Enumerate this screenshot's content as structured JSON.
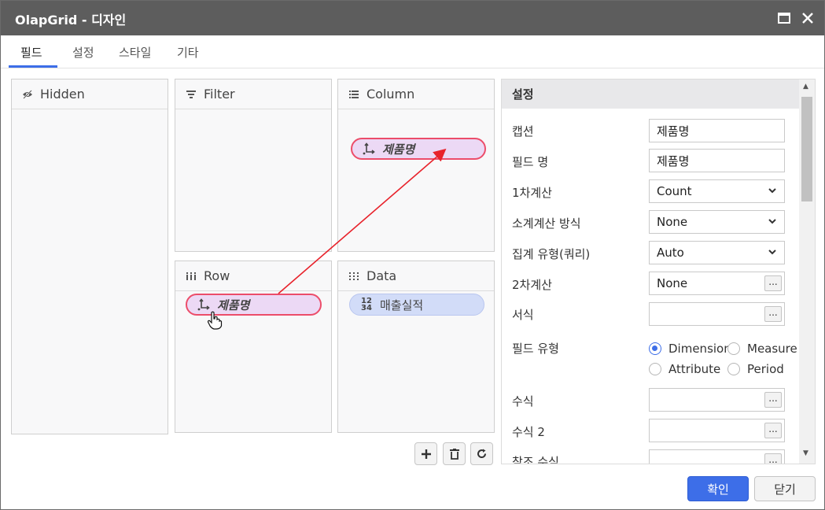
{
  "window": {
    "title": "OlapGrid - 디자인"
  },
  "icons": {
    "maximize": "maximize-icon",
    "close": "close-icon"
  },
  "tabs": [
    {
      "label": "필드",
      "active": true
    },
    {
      "label": "설정",
      "active": false
    },
    {
      "label": "스타일",
      "active": false
    },
    {
      "label": "기타",
      "active": false
    }
  ],
  "panels": {
    "hidden": {
      "label": "Hidden",
      "icon": "eye-off-icon"
    },
    "filter": {
      "label": "Filter",
      "icon": "filter-icon"
    },
    "column": {
      "label": "Column",
      "icon": "list-icon",
      "fields": [
        "제품명"
      ]
    },
    "row": {
      "label": "Row",
      "icon": "columns-icon",
      "fields": [
        "제품명"
      ]
    },
    "data": {
      "label": "Data",
      "icon": "grid-dots-icon",
      "fields": [
        "매출실적"
      ],
      "number_icon_text": [
        "12",
        "34"
      ]
    }
  },
  "toolbar": {
    "add": "add-icon",
    "delete": "trash-icon",
    "refresh": "refresh-icon"
  },
  "settings": {
    "title": "설정",
    "rows": [
      {
        "label": "캡션",
        "value": "제품명",
        "kind": "text"
      },
      {
        "label": "필드 명",
        "value": "제품명",
        "kind": "text"
      },
      {
        "label": "1차계산",
        "value": "Count",
        "kind": "select"
      },
      {
        "label": "소계계산 방식",
        "value": "None",
        "kind": "select"
      },
      {
        "label": "집계 유형(쿼리)",
        "value": "Auto",
        "kind": "select"
      },
      {
        "label": "2차계산",
        "value": "None",
        "kind": "picker"
      },
      {
        "label": "서식",
        "value": "",
        "kind": "picker"
      },
      {
        "label": "수식",
        "value": "",
        "kind": "picker"
      },
      {
        "label": "수식 2",
        "value": "",
        "kind": "picker"
      },
      {
        "label": "참조 수식",
        "value": "",
        "kind": "picker"
      }
    ],
    "field_type": {
      "label": "필드 유형",
      "options": [
        "Dimension",
        "Measure",
        "Attribute",
        "Period"
      ],
      "selected": "Dimension"
    },
    "picker_button_label": "..."
  },
  "footer": {
    "ok_label": "확인",
    "close_label": "닫기"
  },
  "colors": {
    "accent": "#3d6ee8",
    "titlebar": "#5d5d5d",
    "dimension_pill": "#ecd9f5",
    "dimension_border": "#ec4d6a",
    "measure_pill": "#d2dcf8",
    "arrow": "#e8222b"
  }
}
